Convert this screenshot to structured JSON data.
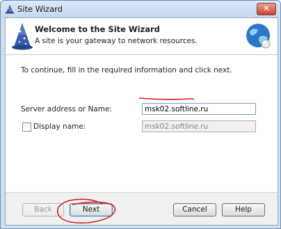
{
  "window": {
    "title": "Site Wizard",
    "close_glyph": "✕"
  },
  "header": {
    "title": "Welcome to the Site Wizard",
    "subtitle": "A site is your gateway to network resources.",
    "left_icon": "wizard-hat-icon",
    "right_icon": "globe-icon"
  },
  "body": {
    "intro": "To continue, fill in the required information and click next.",
    "server": {
      "label": "Server address or Name:",
      "value": "msk02.softline.ru"
    },
    "display": {
      "label": "Display name:",
      "value": "msk02.softline.ru",
      "checked": false
    }
  },
  "buttons": {
    "back": "Back",
    "next": "Next",
    "cancel": "Cancel",
    "help": "Help"
  },
  "colors": {
    "annotation": "#d21f1f",
    "title_bar": "#cfdff1"
  }
}
